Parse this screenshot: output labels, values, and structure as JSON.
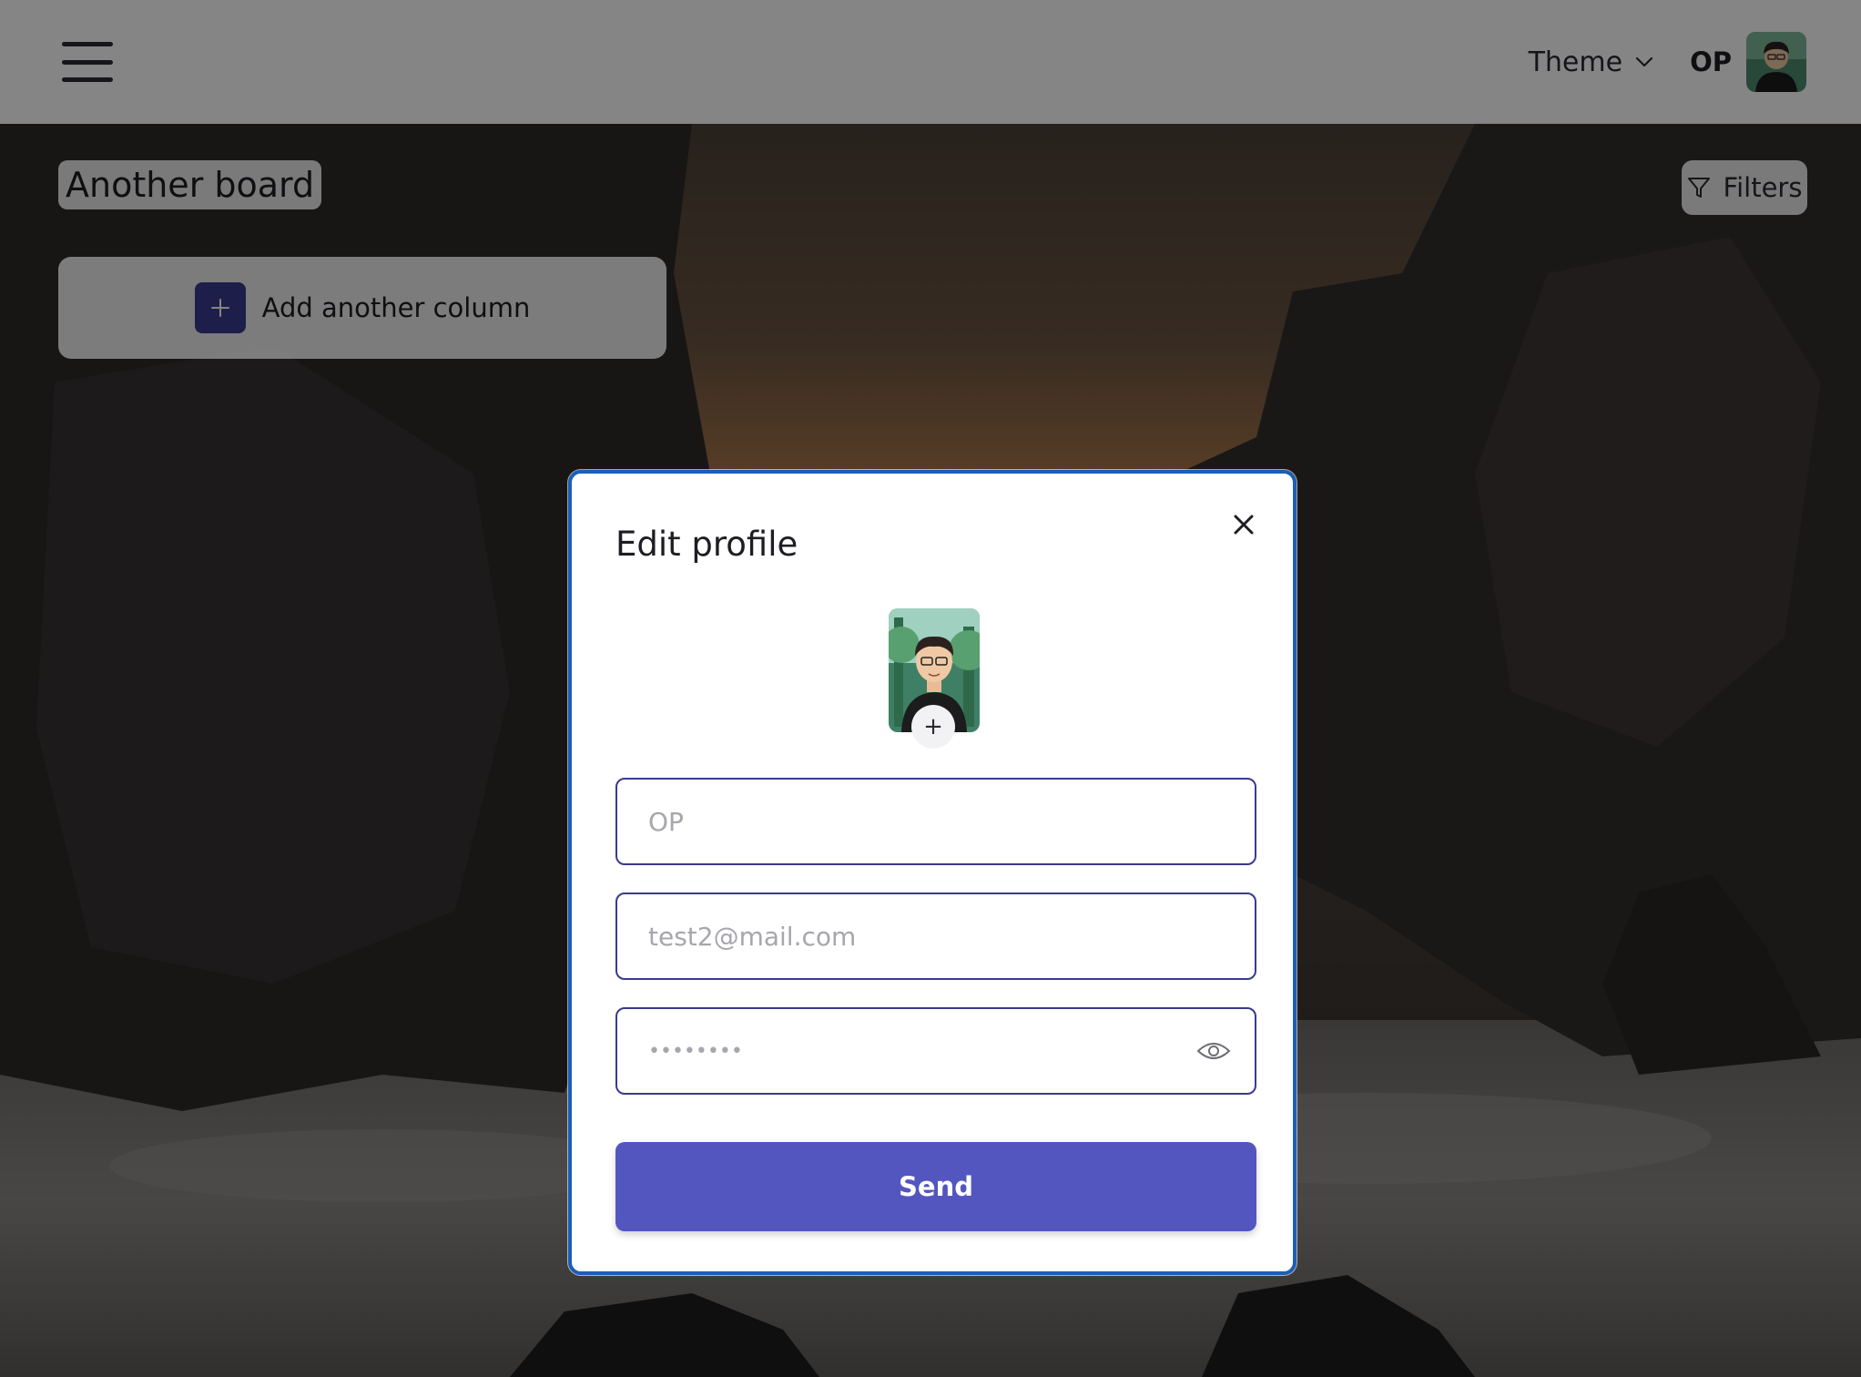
{
  "header": {
    "menu_icon": "hamburger-menu-icon",
    "theme_label": "Theme",
    "user_initials": "OP"
  },
  "board": {
    "title": "Another board",
    "filters_label": "Filters",
    "add_column_label": "Add another column"
  },
  "modal": {
    "title": "Edit profile",
    "name_value": "OP",
    "email_value": "test2@mail.com",
    "password_value": "••••••••",
    "send_label": "Send",
    "upload_symbol": "+"
  },
  "colors": {
    "primary": "#5356bf",
    "modal_border": "#1b5fb6",
    "input_border": "#3a3a8e",
    "add_icon_bg": "#3b3b8f"
  }
}
